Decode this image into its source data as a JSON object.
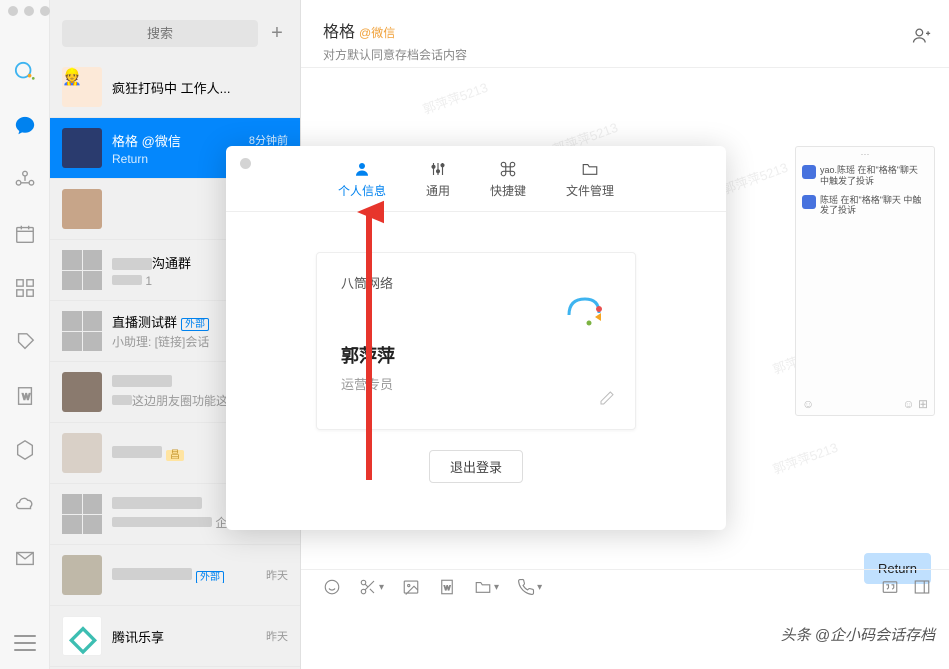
{
  "search": {
    "placeholder": "搜索"
  },
  "chat_list": [
    {
      "title": "疯狂打码中 工作人...",
      "subtitle": "",
      "time": ""
    },
    {
      "title": "格格",
      "badge": "@微信",
      "subtitle": "Return",
      "time": "8分钟前",
      "active": true
    },
    {
      "title": "",
      "subtitle": "",
      "time": ""
    },
    {
      "title": "沟通群",
      "subtitle": "1",
      "time": ""
    },
    {
      "title": "直播测试群",
      "tag": "外部",
      "subtitle": "小助理: [链接]会话",
      "time": ""
    },
    {
      "title": "",
      "subtitle": "这边朋友圈功能这",
      "time": ""
    },
    {
      "title": "",
      "tag_yellow": "昌",
      "subtitle": "",
      "time": ""
    },
    {
      "title": "",
      "subtitle": "企业...",
      "time": ""
    },
    {
      "title": "",
      "tag": "外部",
      "subtitle": "",
      "time": "昨天"
    },
    {
      "title": "腾讯乐享",
      "subtitle": "",
      "time": "昨天"
    }
  ],
  "header": {
    "title": "格格",
    "badge": "@微信",
    "subtitle": "对方默认同意存档会话内容"
  },
  "preview": {
    "line1": "yao.陈瑶 在和\"格格\"聊天 中触发了投诉",
    "line2": "陈瑶 在和\"格格\"聊天 中触发了投诉"
  },
  "bubble_text": "Return",
  "modal": {
    "tabs": [
      {
        "label": "个人信息",
        "icon": "person"
      },
      {
        "label": "通用",
        "icon": "sliders"
      },
      {
        "label": "快捷键",
        "icon": "command"
      },
      {
        "label": "文件管理",
        "icon": "folder"
      }
    ],
    "profile": {
      "org": "八筒网络",
      "name": "郭萍萍",
      "role": "运营专员"
    },
    "logout": "退出登录"
  },
  "watermark_text": "郭萍萍5213",
  "attribution": "头条 @企小码会话存档"
}
